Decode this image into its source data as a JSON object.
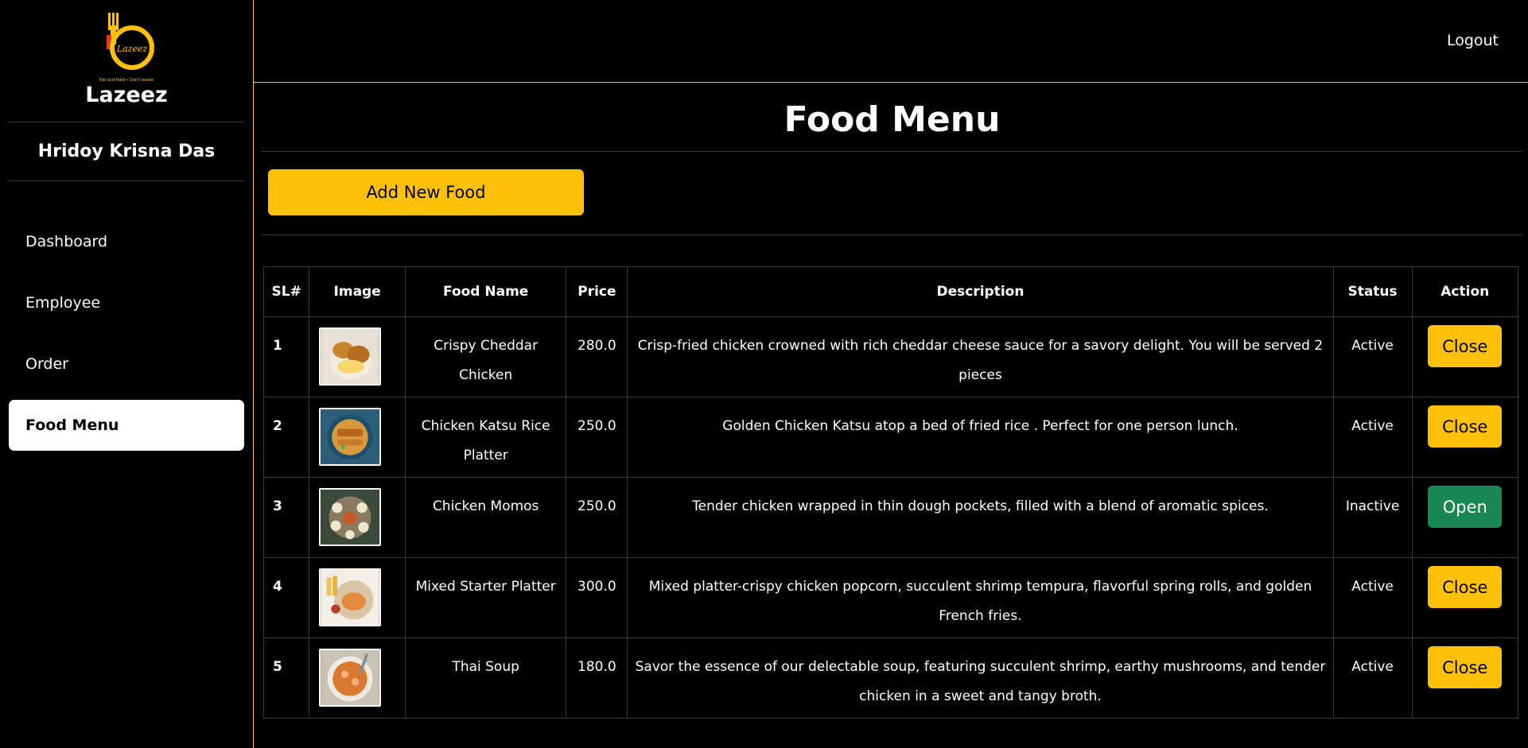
{
  "brand": {
    "name": "Lazeez",
    "logo_text": "Lazeez",
    "logo_tagline": "Eat and feed • Don't waste",
    "accent_color": "#ffc107"
  },
  "user": {
    "name": "Hridoy Krisna Das"
  },
  "nav": {
    "items": [
      {
        "label": "Dashboard",
        "active": false
      },
      {
        "label": "Employee",
        "active": false
      },
      {
        "label": "Order",
        "active": false
      },
      {
        "label": "Food Menu",
        "active": true
      }
    ]
  },
  "header": {
    "logout_label": "Logout"
  },
  "page": {
    "title": "Food Menu",
    "add_button_label": "Add New Food"
  },
  "table": {
    "columns": [
      "SL#",
      "Image",
      "Food Name",
      "Price",
      "Description",
      "Status",
      "Action"
    ],
    "rows": [
      {
        "sl": "1",
        "name": "Crispy Cheddar Chicken",
        "price": "280.0",
        "description": "Crisp-fried chicken crowned with rich cheddar cheese sauce for a savory delight. You will be served 2 pieces",
        "status": "Active",
        "action": "Close",
        "action_color": "#ffc107"
      },
      {
        "sl": "2",
        "name": "Chicken Katsu Rice Platter",
        "price": "250.0",
        "description": "Golden Chicken Katsu atop a bed of fried rice . Perfect for one person lunch.",
        "status": "Active",
        "action": "Close",
        "action_color": "#ffc107"
      },
      {
        "sl": "3",
        "name": "Chicken Momos",
        "price": "250.0",
        "description": "Tender chicken wrapped in thin dough pockets, filled with a blend of aromatic spices.",
        "status": "Inactive",
        "action": "Open",
        "action_color": "#198754"
      },
      {
        "sl": "4",
        "name": "Mixed Starter Platter",
        "price": "300.0",
        "description": "Mixed platter-crispy chicken popcorn, succulent shrimp tempura, flavorful spring rolls, and golden French fries.",
        "status": "Active",
        "action": "Close",
        "action_color": "#ffc107"
      },
      {
        "sl": "5",
        "name": "Thai Soup",
        "price": "180.0",
        "description": "Savor the essence of our delectable soup, featuring succulent shrimp, earthy mushrooms, and tender chicken in a sweet and tangy broth.",
        "status": "Active",
        "action": "Close",
        "action_color": "#ffc107"
      }
    ]
  }
}
